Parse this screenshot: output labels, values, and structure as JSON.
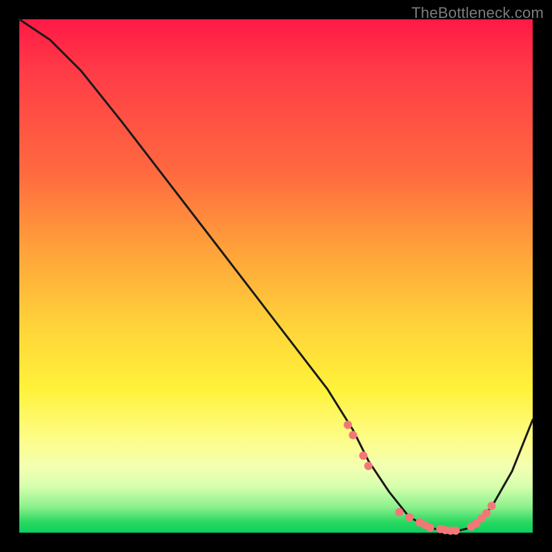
{
  "watermark": "TheBottleneck.com",
  "colors": {
    "background": "#000000",
    "curve_stroke": "#1a1a1a",
    "marker_fill": "#f27878",
    "gradient_top": "#ff1945",
    "gradient_bottom": "#0bd060"
  },
  "chart_data": {
    "type": "line",
    "title": "",
    "xlabel": "",
    "ylabel": "",
    "xlim": [
      0,
      100
    ],
    "ylim": [
      0,
      100
    ],
    "x": [
      0,
      6,
      12,
      20,
      30,
      40,
      50,
      60,
      65,
      68,
      72,
      76,
      80,
      84,
      88,
      92,
      96,
      100
    ],
    "values": [
      100,
      96,
      90,
      80,
      67,
      54,
      41,
      28,
      20,
      14,
      8,
      3,
      1,
      0,
      1,
      5,
      12,
      22
    ],
    "markers": {
      "x": [
        64,
        65,
        67,
        68,
        74,
        76,
        78,
        79,
        80,
        82,
        83,
        84,
        85,
        88,
        89,
        90,
        91,
        92
      ],
      "values": [
        21,
        19,
        15,
        13,
        4,
        3,
        2,
        1.5,
        1,
        0.7,
        0.5,
        0.4,
        0.4,
        1.2,
        1.8,
        2.8,
        3.8,
        5.2
      ]
    }
  }
}
